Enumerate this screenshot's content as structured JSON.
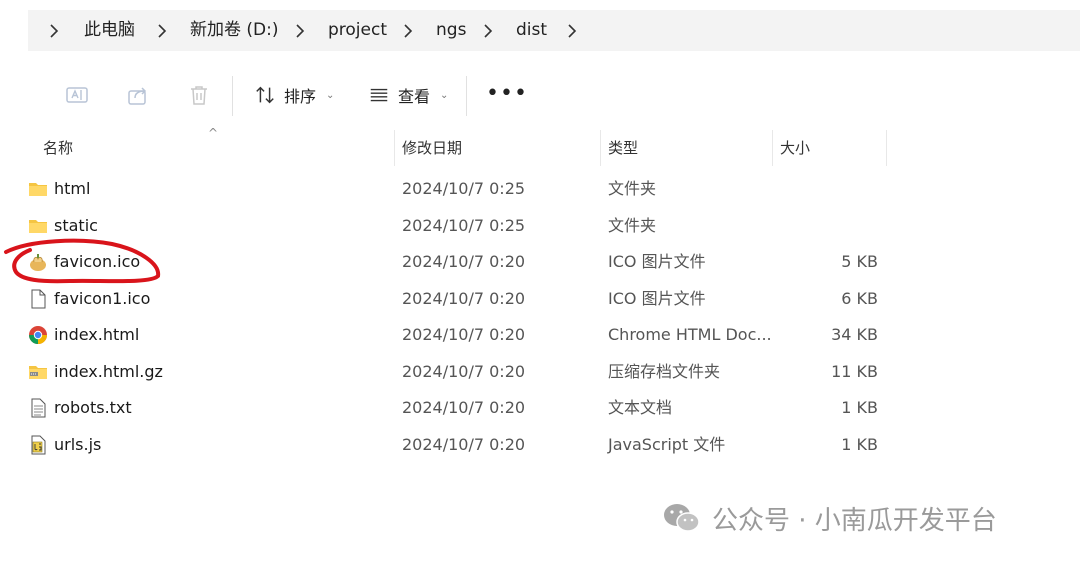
{
  "breadcrumb": {
    "items": [
      "此电脑",
      "新加卷 (D:)",
      "project",
      "ngs",
      "dist"
    ]
  },
  "toolbar": {
    "sort_label": "排序",
    "view_label": "查看",
    "more_label": "•••",
    "caret": "⌄"
  },
  "columns": {
    "name": "名称",
    "date": "修改日期",
    "type": "类型",
    "size": "大小"
  },
  "files": [
    {
      "name": "html",
      "date": "2024/10/7 0:25",
      "type": "文件夹",
      "size": "",
      "icon": "folder-icon"
    },
    {
      "name": "static",
      "date": "2024/10/7 0:25",
      "type": "文件夹",
      "size": "",
      "icon": "folder-icon"
    },
    {
      "name": "favicon.ico",
      "date": "2024/10/7 0:20",
      "type": "ICO 图片文件",
      "size": "5 KB",
      "icon": "favicon-image-icon"
    },
    {
      "name": "favicon1.ico",
      "date": "2024/10/7 0:20",
      "type": "ICO 图片文件",
      "size": "6 KB",
      "icon": "blank-file-icon"
    },
    {
      "name": "index.html",
      "date": "2024/10/7 0:20",
      "type": "Chrome HTML Doc...",
      "size": "34 KB",
      "icon": "chrome-icon"
    },
    {
      "name": "index.html.gz",
      "date": "2024/10/7 0:20",
      "type": "压缩存档文件夹",
      "size": "11 KB",
      "icon": "zip-folder-icon"
    },
    {
      "name": "robots.txt",
      "date": "2024/10/7 0:20",
      "type": "文本文档",
      "size": "1 KB",
      "icon": "text-file-icon"
    },
    {
      "name": "urls.js",
      "date": "2024/10/7 0:20",
      "type": "JavaScript 文件",
      "size": "1 KB",
      "icon": "js-file-icon"
    }
  ],
  "watermark": {
    "text": "公众号 · 小南瓜开发平台"
  },
  "colors": {
    "annotation": "#d9141b",
    "folder": "#f5c542",
    "watermark": "#9a9a9a"
  }
}
